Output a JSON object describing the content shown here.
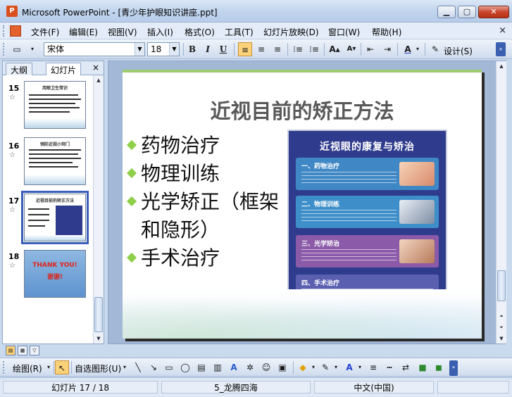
{
  "window": {
    "title": "Microsoft PowerPoint - [青少年护眼知识讲座.ppt]",
    "app_icon": "powerpoint-icon",
    "controls": {
      "minimize": "0",
      "maximize": "1",
      "close": "r"
    }
  },
  "menu": {
    "items": [
      "文件(F)",
      "编辑(E)",
      "视图(V)",
      "插入(I)",
      "格式(O)",
      "工具(T)",
      "幻灯片放映(D)",
      "窗口(W)",
      "帮助(H)"
    ],
    "close_glyph": "×"
  },
  "toolbar": {
    "font_name": "宋体",
    "font_size": "18",
    "bold": "B",
    "italic": "I",
    "underline": "U",
    "grow_font": "A",
    "shrink_font": "A",
    "font_color": "A",
    "design_label": "设计(S)"
  },
  "left_pane": {
    "tabs": [
      "大纲",
      "幻灯片"
    ],
    "close_glyph": "×",
    "slides": [
      {
        "number": "15",
        "title": "用眼卫生常识"
      },
      {
        "number": "16",
        "title": "预防近视小窍门"
      },
      {
        "number": "17",
        "title": "近视目前的矫正方法"
      },
      {
        "number": "18",
        "title": "THANK YOU!",
        "subtitle": "谢谢!"
      }
    ],
    "selected_index": 2
  },
  "slide": {
    "title": "近视目前的矫正方法",
    "bullets": [
      "药物治疗",
      "物理训练",
      "光学矫正（框架和隐形）",
      "手术治疗"
    ],
    "poster": {
      "title": "近视眼的康复与矫治",
      "cards": [
        {
          "label": "一、药物治疗",
          "color": "#3f88c5"
        },
        {
          "label": "二、物理训练",
          "color": "#3e8fc9"
        },
        {
          "label": "三、光学矫治",
          "color": "#8b5aa8"
        },
        {
          "label": "四、手术治疗",
          "color": "#5a5fb0"
        }
      ]
    }
  },
  "drawing_toolbar": {
    "draw_label": "绘图(R)",
    "autoshapes_label": "自选图形(U)"
  },
  "status": {
    "slide_position": "幻灯片 17 / 18",
    "design_name": "5_龙腾四海",
    "language": "中文(中国)"
  },
  "colors": {
    "title_text": "#595959",
    "bullet_mark": "#8fcf4a",
    "poster_bg": "#2f3c8d",
    "selection": "#3b5fb8"
  }
}
